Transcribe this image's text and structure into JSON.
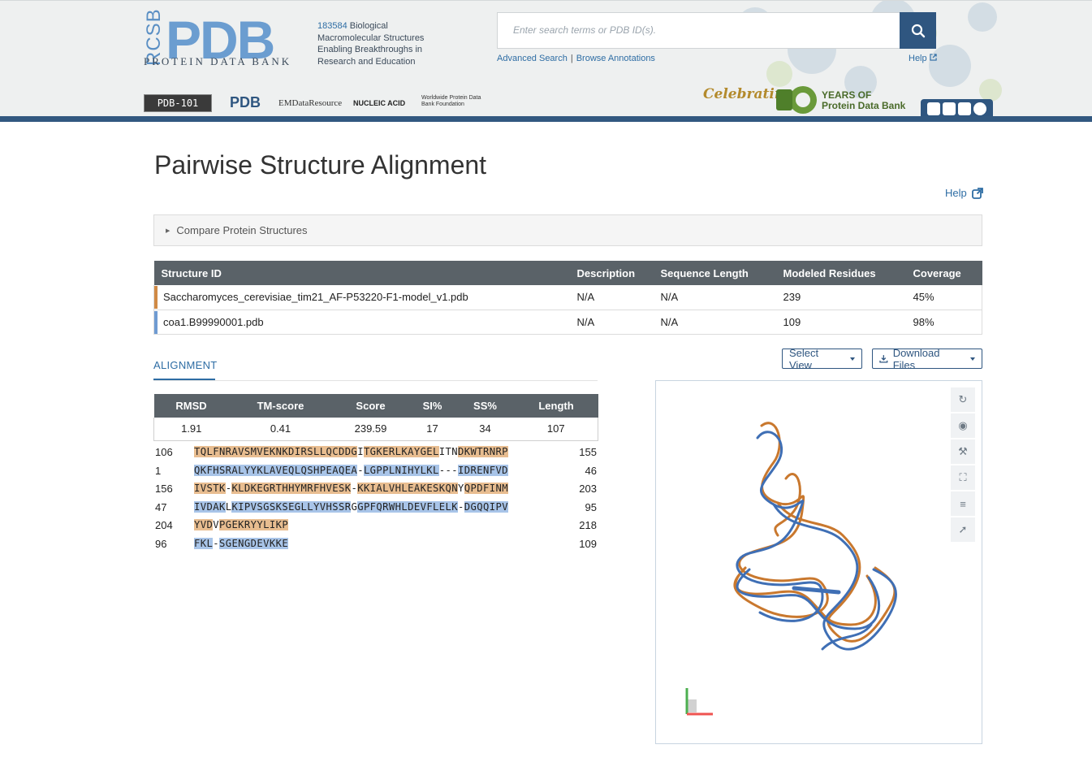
{
  "header": {
    "logo_rcsb": "RCSB",
    "logo_pdb": "PDB",
    "logo_subtitle": "PROTEIN DATA BANK",
    "entry_count": "183584",
    "tagline_rest": " Biological Macromolecular Structures Enabling Breakthroughs in Research and Education",
    "search_placeholder": "Enter search terms or PDB ID(s).",
    "advanced_search": "Advanced Search",
    "link_separator": "|",
    "browse_annotations": "Browse Annotations",
    "help": "Help",
    "partners": {
      "pdb101": "PDB-101",
      "wwpdb": "PDB",
      "emdb": "EMDataResource",
      "ndb": "NUCLEIC ACID DATABASE",
      "wwpdb_foundation": "Worldwide Protein Data Bank Foundation"
    },
    "celebrating": "Celebrating",
    "years_line1": "YEARS OF",
    "years_line2": "Protein Data Bank",
    "social_icons": [
      "facebook-icon",
      "twitter-icon",
      "youtube-icon",
      "github-icon"
    ]
  },
  "page": {
    "title": "Pairwise Structure Alignment",
    "help": "Help",
    "compare_panel": "Compare Protein Structures"
  },
  "structures": {
    "headers": [
      "Structure ID",
      "Description",
      "Sequence Length",
      "Modeled Residues",
      "Coverage"
    ],
    "rows": [
      {
        "id": "Saccharomyces_cerevisiae_tim21_AF-P53220-F1-model_v1.pdb",
        "description": "N/A",
        "seq_length": "N/A",
        "modeled": "239",
        "coverage": "45%",
        "color": "#d08a45"
      },
      {
        "id": "coa1.B99990001.pdb",
        "description": "N/A",
        "seq_length": "N/A",
        "modeled": "109",
        "coverage": "98%",
        "color": "#6f9bd2"
      }
    ]
  },
  "alignment": {
    "tab_label": "ALIGNMENT",
    "select_view": "Select View",
    "download_files": "Download Files",
    "metrics_headers": [
      "RMSD",
      "TM-score",
      "Score",
      "SI%",
      "SS%",
      "Length"
    ],
    "metrics_values": [
      "1.91",
      "0.41",
      "239.59",
      "17",
      "34",
      "107"
    ],
    "rows": [
      {
        "start": "106",
        "end": "155",
        "segments": [
          [
            "a",
            "TQLFNRAVSMVEKNKDIRSLLQCDDG"
          ],
          [
            "n",
            "I"
          ],
          [
            "a",
            "TGKERLKAYGEL"
          ],
          [
            "n",
            "ITN"
          ],
          [
            "a",
            "DKWTRNRP"
          ]
        ]
      },
      {
        "start": "1",
        "end": "46",
        "segments": [
          [
            "b",
            "QKFHSRALYYKLAVEQLQSHPEAQEA"
          ],
          [
            "n",
            "-"
          ],
          [
            "b",
            "LGPPLNIHYLKL"
          ],
          [
            "n",
            "---"
          ],
          [
            "b",
            "IDRENFVD"
          ]
        ]
      },
      {
        "start": "156",
        "end": "203",
        "segments": [
          [
            "a",
            "IVSTK"
          ],
          [
            "n",
            "-"
          ],
          [
            "a",
            "KLDKEGRTHHYMRFHVESK"
          ],
          [
            "n",
            "-"
          ],
          [
            "a",
            "KKIALVHLEAKESKQN"
          ],
          [
            "n",
            "Y"
          ],
          [
            "a",
            "QPDFINM"
          ]
        ]
      },
      {
        "start": "47",
        "end": "95",
        "segments": [
          [
            "b",
            "IVDAK"
          ],
          [
            "n",
            "L"
          ],
          [
            "b",
            "KIPVSGSKSEGLLYVHSSR"
          ],
          [
            "n",
            "G"
          ],
          [
            "b",
            "GPFQRWHLDEVFLELK"
          ],
          [
            "n",
            "-"
          ],
          [
            "b",
            "DGQQIPV"
          ]
        ]
      },
      {
        "start": "204",
        "end": "218",
        "segments": [
          [
            "a",
            "YVD"
          ],
          [
            "n",
            "V"
          ],
          [
            "a",
            "PGEKRYYLIKP"
          ]
        ]
      },
      {
        "start": "96",
        "end": "109",
        "segments": [
          [
            "b",
            "FKL"
          ],
          [
            "n",
            "-"
          ],
          [
            "b",
            "SGENGDEVKKE"
          ]
        ]
      }
    ]
  },
  "viewer": {
    "tools": [
      "reset-icon",
      "camera-icon",
      "wrench-icon",
      "expand-icon",
      "settings-icon",
      "cursor-icon"
    ],
    "colors": {
      "structure_a": "#c9782e",
      "structure_b": "#3f6fb5"
    }
  }
}
